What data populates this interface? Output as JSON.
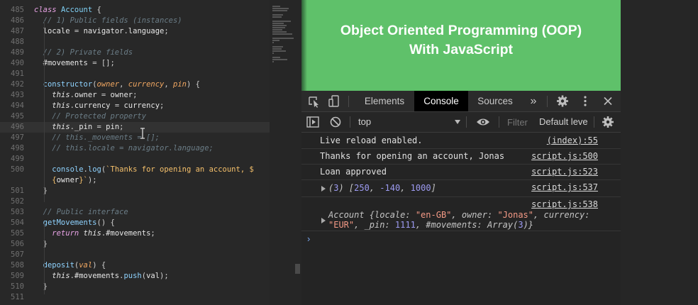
{
  "editor": {
    "lines": [
      {
        "n": "485",
        "tokens": [
          [
            "kw",
            "class "
          ],
          [
            "cls",
            "Account"
          ],
          [
            "punc",
            " {"
          ]
        ]
      },
      {
        "n": "486",
        "tokens": [
          [
            "cm",
            "  // 1) Public fields (instances)"
          ]
        ]
      },
      {
        "n": "487",
        "tokens": [
          [
            "prop",
            "  locale "
          ],
          [
            "punc",
            "= "
          ],
          [
            "prop",
            "navigator"
          ],
          [
            "punc",
            "."
          ],
          [
            "prop",
            "language"
          ],
          [
            "punc",
            ";"
          ]
        ]
      },
      {
        "n": "488",
        "tokens": []
      },
      {
        "n": "489",
        "tokens": [
          [
            "cm",
            "  // 2) Private fields"
          ]
        ]
      },
      {
        "n": "490",
        "tokens": [
          [
            "prop",
            "  #movements "
          ],
          [
            "punc",
            "= [];"
          ]
        ]
      },
      {
        "n": "491",
        "tokens": []
      },
      {
        "n": "492",
        "tokens": [
          [
            "fn",
            "  constructor"
          ],
          [
            "punc",
            "("
          ],
          [
            "param",
            "owner"
          ],
          [
            "punc",
            ", "
          ],
          [
            "param",
            "currency"
          ],
          [
            "punc",
            ", "
          ],
          [
            "param",
            "pin"
          ],
          [
            "punc",
            ") {"
          ]
        ]
      },
      {
        "n": "493",
        "tokens": [
          [
            "this",
            "    this"
          ],
          [
            "punc",
            "."
          ],
          [
            "prop",
            "owner "
          ],
          [
            "punc",
            "= "
          ],
          [
            "prop",
            "owner"
          ],
          [
            "punc",
            ";"
          ]
        ]
      },
      {
        "n": "494",
        "tokens": [
          [
            "this",
            "    this"
          ],
          [
            "punc",
            "."
          ],
          [
            "prop",
            "currency "
          ],
          [
            "punc",
            "= "
          ],
          [
            "prop",
            "currency"
          ],
          [
            "punc",
            ";"
          ]
        ]
      },
      {
        "n": "495",
        "tokens": [
          [
            "cm",
            "    // Protected property"
          ]
        ]
      },
      {
        "n": "496",
        "tokens": [
          [
            "this",
            "    this"
          ],
          [
            "punc",
            "."
          ],
          [
            "prop",
            "_pin "
          ],
          [
            "punc",
            "= "
          ],
          [
            "prop",
            "pin"
          ],
          [
            "punc",
            ";"
          ]
        ]
      },
      {
        "n": "497",
        "tokens": [
          [
            "cm",
            "    // this._movements = [];"
          ]
        ]
      },
      {
        "n": "498",
        "tokens": [
          [
            "cm",
            "    // this.locale = navigator.language;"
          ]
        ]
      },
      {
        "n": "499",
        "tokens": []
      },
      {
        "n": "500",
        "tokens": [
          [
            "fn",
            "    console"
          ],
          [
            "punc",
            "."
          ],
          [
            "fn",
            "log"
          ],
          [
            "punc",
            "("
          ],
          [
            "str",
            "`Thanks for opening an account, $"
          ]
        ]
      },
      {
        "n": "",
        "tokens": [
          [
            "str",
            "    {"
          ],
          [
            "prop",
            "owner"
          ],
          [
            "str",
            "}`"
          ],
          [
            "punc",
            ");"
          ]
        ]
      },
      {
        "n": "501",
        "tokens": [
          [
            "punc",
            "  }"
          ]
        ]
      },
      {
        "n": "502",
        "tokens": []
      },
      {
        "n": "503",
        "tokens": [
          [
            "cm",
            "  // Public interface"
          ]
        ]
      },
      {
        "n": "504",
        "tokens": [
          [
            "fn",
            "  getMovements"
          ],
          [
            "punc",
            "() {"
          ]
        ]
      },
      {
        "n": "505",
        "tokens": [
          [
            "kw",
            "    return "
          ],
          [
            "this",
            "this"
          ],
          [
            "punc",
            "."
          ],
          [
            "prop",
            "#movements"
          ],
          [
            "punc",
            ";"
          ]
        ]
      },
      {
        "n": "506",
        "tokens": [
          [
            "punc",
            "  }"
          ]
        ]
      },
      {
        "n": "507",
        "tokens": []
      },
      {
        "n": "508",
        "tokens": [
          [
            "fn",
            "  deposit"
          ],
          [
            "punc",
            "("
          ],
          [
            "param",
            "val"
          ],
          [
            "punc",
            ") {"
          ]
        ]
      },
      {
        "n": "509",
        "tokens": [
          [
            "this",
            "    this"
          ],
          [
            "punc",
            "."
          ],
          [
            "prop",
            "#movements"
          ],
          [
            "punc",
            "."
          ],
          [
            "fn",
            "push"
          ],
          [
            "punc",
            "("
          ],
          [
            "prop",
            "val"
          ],
          [
            "punc",
            ");"
          ]
        ]
      },
      {
        "n": "510",
        "tokens": [
          [
            "punc",
            "  }"
          ]
        ]
      },
      {
        "n": "511",
        "tokens": []
      }
    ]
  },
  "banner": {
    "title_line1": "Object Oriented Programming (OOP)",
    "title_line2": "With JavaScript"
  },
  "devtools": {
    "tabs": [
      "Elements",
      "Console",
      "Sources"
    ],
    "active_tab": "Console",
    "more_tabs": "»",
    "context": "top",
    "filter_placeholder": "Filter",
    "level": "Default leve",
    "messages": [
      {
        "text": "Live reload enabled.",
        "source": "(index):55"
      },
      {
        "text": "Thanks for opening an account, Jonas",
        "source": "script.js:500"
      },
      {
        "text": "Loan approved",
        "source": "script.js:523"
      },
      {
        "text": "(3) [250, -140, 1000]",
        "source": "script.js:537"
      },
      {
        "text": "Account {locale: \"en-GB\", owner: \"Jonas\", currency: \"EUR\", _pin: 1111, #movements: Array(3)}",
        "source": "script.js:538"
      }
    ],
    "prompt": "›"
  },
  "icons": [
    "inspect-icon",
    "device-toolbar-icon",
    "settings-gear-icon",
    "kebab-menu-icon",
    "close-icon",
    "sidebar-toggle-icon",
    "clear-console-icon",
    "eye-icon",
    "console-settings-gear-icon",
    "text-cursor-icon"
  ],
  "colors": {
    "banner": "#5fc16a",
    "active_tab": "#000000",
    "editor_bg": "#282828"
  }
}
